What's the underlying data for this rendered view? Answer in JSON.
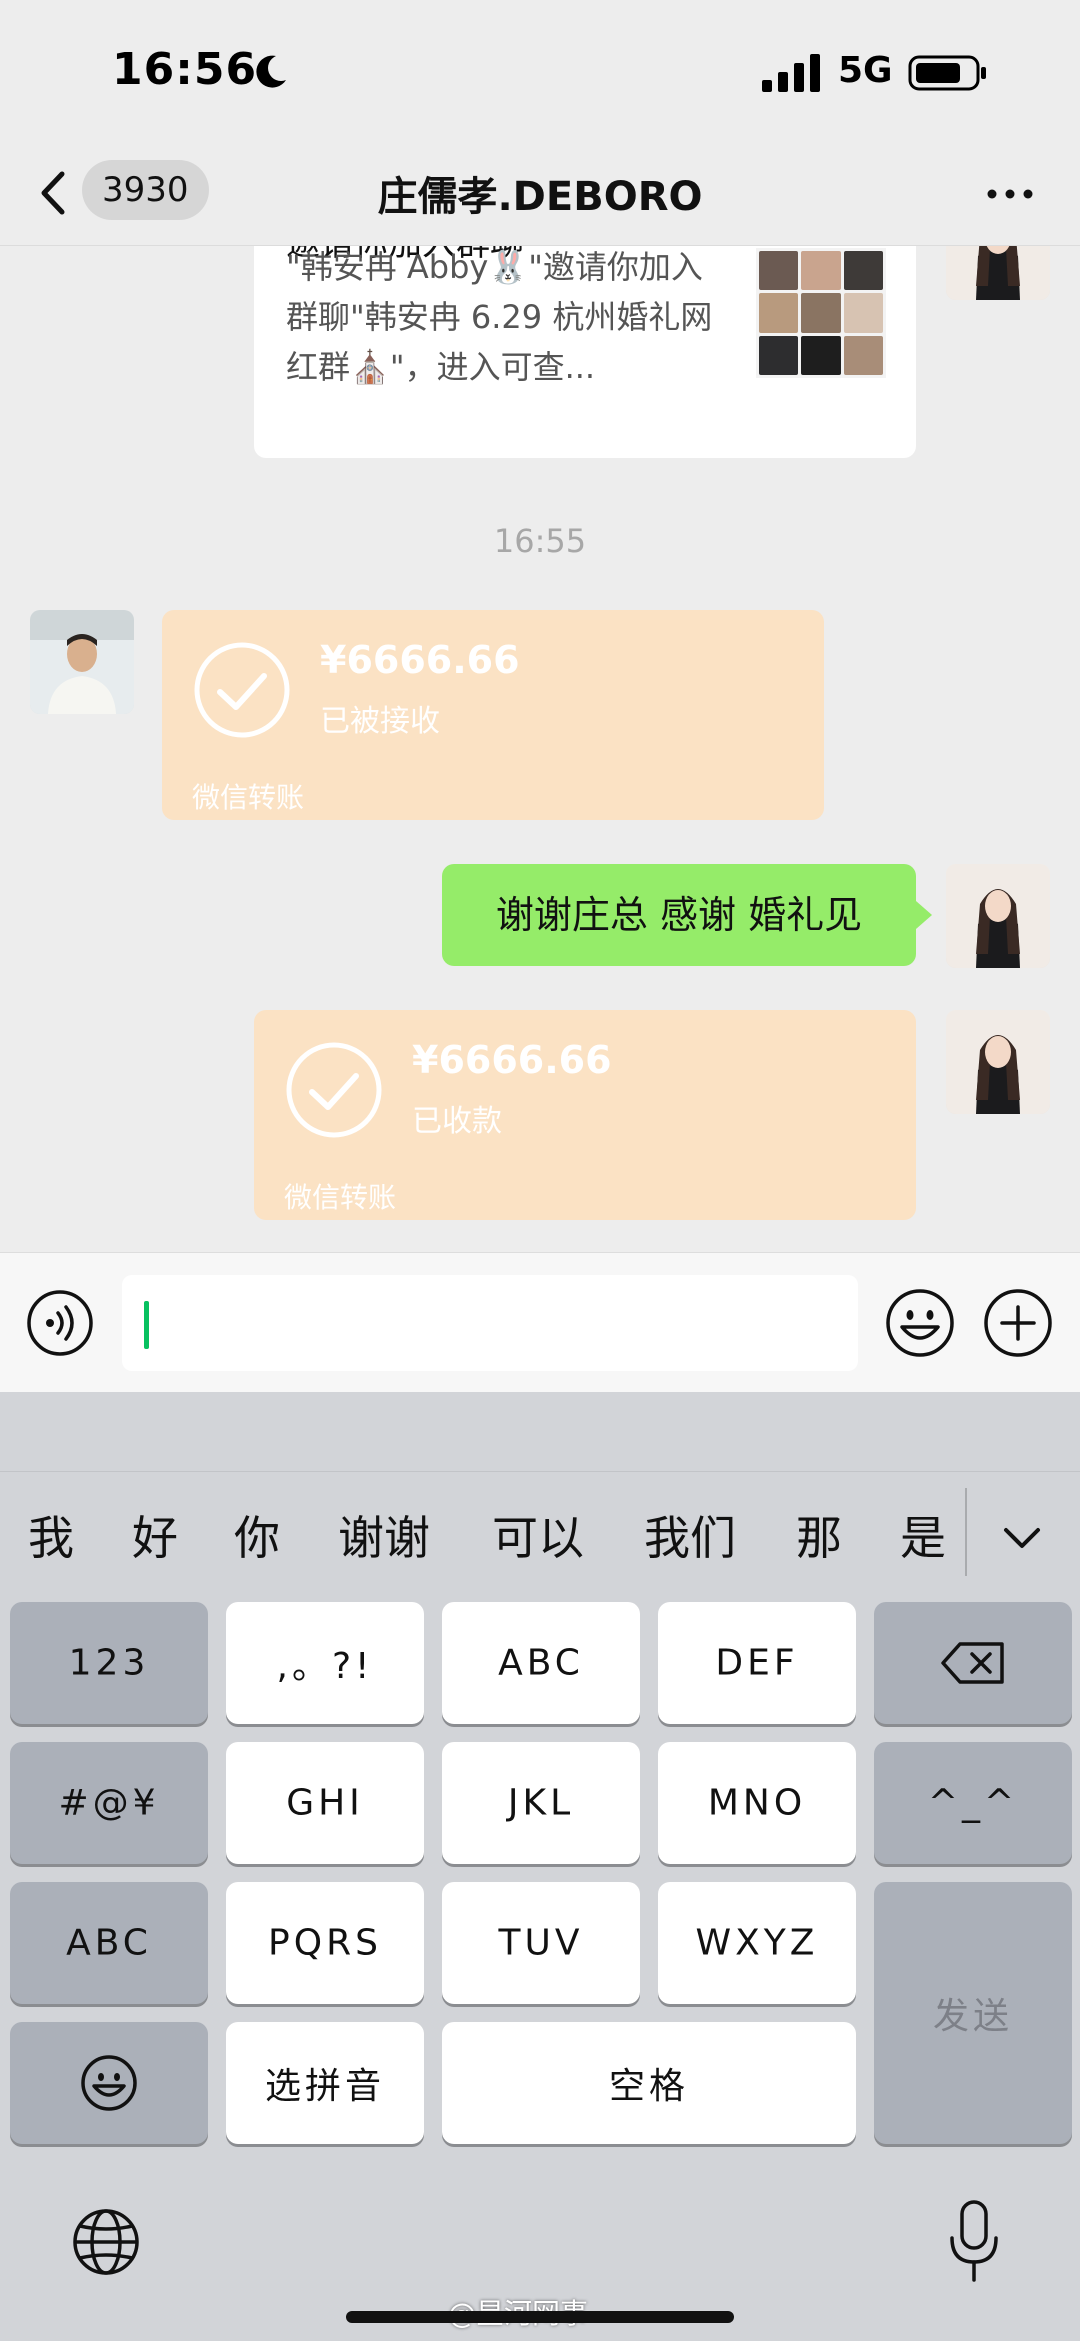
{
  "status_bar": {
    "time": "16:56",
    "network": "5G"
  },
  "nav": {
    "unread_count": "3930",
    "title": "庄儒孝.DEBORO"
  },
  "chat": {
    "invite_card": {
      "title": "邀请你加入群聊",
      "description": "\"韩安冉 Abby🐰\"邀请你加入群聊\"韩安冉 6.29 杭州婚礼网红群⛪\"，进入可查..."
    },
    "timestamp": "16:55",
    "transfer_received": {
      "amount": "¥6666.66",
      "status": "已被接收",
      "footer": "微信转账"
    },
    "text_message": "谢谢庄总 感谢 婚礼见",
    "transfer_collected": {
      "amount": "¥6666.66",
      "status": "已收款",
      "footer": "微信转账"
    }
  },
  "keyboard": {
    "candidates": [
      "我",
      "好",
      "你",
      "谢谢",
      "可以",
      "我们",
      "那",
      "是"
    ],
    "keys": {
      "num": "123",
      "punct": ",。?!",
      "abc": "ABC",
      "def": "DEF",
      "symbols": "#@¥",
      "ghi": "GHI",
      "jkl": "JKL",
      "mno": "MNO",
      "face": "^_^",
      "abc_mode": "ABC",
      "pqrs": "PQRS",
      "tuv": "TUV",
      "wxyz": "WXYZ",
      "send": "发送",
      "pinyin": "选拼音",
      "space": "空格"
    }
  },
  "watermark": "@星河网事",
  "colors": {
    "bubble_green": "#95ec69",
    "transfer_orange": "#fbe2c4",
    "cursor_green": "#07c160",
    "keyboard_bg": "#d2d4d8"
  }
}
